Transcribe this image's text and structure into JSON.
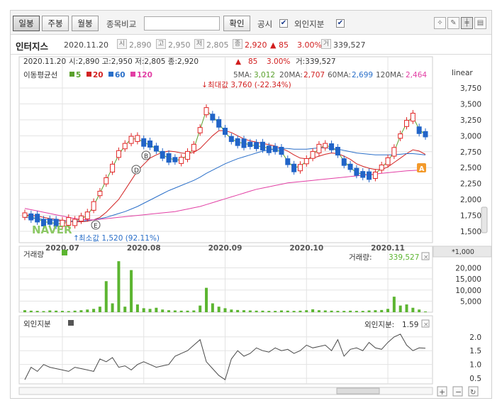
{
  "toolbar": {
    "periods": [
      "일봉",
      "주봉",
      "월봉"
    ],
    "compare_label": "종목비교",
    "compare_value": "",
    "confirm_label": "확인",
    "disclosure_label": "공시",
    "foreign_label": "외인지분",
    "icons": [
      "lightbulb-icon",
      "pencil-icon",
      "chart-type-icon",
      "print-icon"
    ]
  },
  "info": {
    "name": "인터지스",
    "date": "2020.11.20",
    "open_tag": "시",
    "open": "2,890",
    "high_tag": "고",
    "high": "2,950",
    "low_tag": "저",
    "low": "2,805",
    "close_tag": "종",
    "close": "2,920",
    "change": "▲ 85",
    "change_pct": "3.00%",
    "volume_tag": "거",
    "volume": "339,527"
  },
  "legend_line": {
    "date": "2020.11.20",
    "text": "시:2,890 고:2,950 저:2,805 종:2,920",
    "arrow": "▲",
    "change": "85",
    "pct": "3.00%",
    "vol": "거:339,527"
  },
  "ma_legend": {
    "title": "이동평균선",
    "items": [
      {
        "label": "5",
        "color": "#5aa02c"
      },
      {
        "label": "20",
        "color": "#d22222"
      },
      {
        "label": "60",
        "color": "#2a6fc9"
      },
      {
        "label": "120",
        "color": "#e23fa4"
      }
    ]
  },
  "ma_values": {
    "ma5_label": "5MA:",
    "ma5": "3,012",
    "ma20_label": "20MA:",
    "ma20": "2,707",
    "ma60_label": "60MA:",
    "ma60": "2,699",
    "ma120_label": "120MA:",
    "ma120": "2,464"
  },
  "scale_label": "linear",
  "max_annotation": "최대값 3,760 (-22.34%)",
  "min_annotation": "최소값 1,520 (92.11%)",
  "watermark": "NAVER",
  "marker_labels": [
    "B",
    "D",
    "E"
  ],
  "alert_marker": "A",
  "volume_panel": {
    "title": "거래량",
    "value_label": "거래량:",
    "value": "339,527",
    "unit": "*1,000"
  },
  "foreign_panel": {
    "title": "외인지분",
    "value_label": "외인지분:",
    "value": "1.59"
  },
  "colors": {
    "up": "#e12525",
    "down": "#2164c8",
    "volume": "#5cb531",
    "foreign": "#4a4a4a",
    "grid": "#e3e3e3"
  },
  "chart_data": [
    {
      "type": "line",
      "title": "",
      "x_ticks": [
        "2020.07",
        "2020.08",
        "2020.09",
        "2020.10",
        "2020.11"
      ],
      "y_ticks": [
        1500,
        1750,
        2000,
        2250,
        2500,
        2750,
        3000,
        3250,
        3500,
        3750
      ],
      "ylim": [
        1400,
        3850
      ],
      "series": [
        {
          "name": "5",
          "values": [
            1760,
            1720,
            1700,
            1650,
            1640,
            1620,
            1620,
            1650,
            1660,
            1700,
            1750,
            1900,
            2100,
            2300,
            2500,
            2700,
            2850,
            2950,
            2950,
            2900,
            2850,
            2800,
            2700,
            2650,
            2620,
            2620,
            2700,
            2800,
            3100,
            3400,
            3300,
            3200,
            3050,
            2950,
            2900,
            2880,
            2860,
            2840,
            2830,
            2800,
            2780,
            2750,
            2600,
            2500,
            2520,
            2600,
            2700,
            2800,
            2850,
            2820,
            2750,
            2600,
            2500,
            2420,
            2400,
            2380,
            2400,
            2500,
            2600,
            2750,
            3000,
            3200,
            3300,
            3100,
            3012
          ]
        },
        {
          "name": "20",
          "values": [
            1760,
            1750,
            1740,
            1720,
            1700,
            1690,
            1670,
            1660,
            1650,
            1650,
            1660,
            1680,
            1720,
            1800,
            1900,
            2000,
            2150,
            2300,
            2450,
            2550,
            2650,
            2700,
            2740,
            2760,
            2750,
            2730,
            2720,
            2740,
            2800,
            2900,
            3000,
            3080,
            3080,
            3050,
            3000,
            2950,
            2920,
            2900,
            2880,
            2860,
            2840,
            2800,
            2760,
            2700,
            2650,
            2640,
            2650,
            2680,
            2710,
            2730,
            2720,
            2680,
            2630,
            2560,
            2520,
            2490,
            2470,
            2470,
            2510,
            2580,
            2650,
            2720,
            2780,
            2760,
            2707
          ]
        },
        {
          "name": "60",
          "values": [
            1720,
            1710,
            1700,
            1690,
            1680,
            1670,
            1660,
            1660,
            1660,
            1660,
            1670,
            1680,
            1700,
            1720,
            1750,
            1780,
            1810,
            1850,
            1890,
            1940,
            1990,
            2040,
            2090,
            2140,
            2180,
            2220,
            2260,
            2300,
            2350,
            2410,
            2460,
            2510,
            2560,
            2600,
            2640,
            2670,
            2700,
            2730,
            2760,
            2780,
            2790,
            2800,
            2800,
            2790,
            2790,
            2790,
            2800,
            2810,
            2810,
            2800,
            2790,
            2770,
            2750,
            2730,
            2720,
            2710,
            2700,
            2700,
            2700,
            2700,
            2710,
            2720,
            2720,
            2710,
            2699
          ]
        },
        {
          "name": "120",
          "values": [
            1860,
            1840,
            1820,
            1800,
            1780,
            1760,
            1740,
            1720,
            1700,
            1690,
            1680,
            1680,
            1690,
            1700,
            1710,
            1720,
            1730,
            1740,
            1750,
            1760,
            1770,
            1780,
            1790,
            1800,
            1810,
            1830,
            1850,
            1870,
            1890,
            1920,
            1950,
            1980,
            2010,
            2040,
            2070,
            2100,
            2130,
            2160,
            2180,
            2200,
            2220,
            2240,
            2260,
            2270,
            2280,
            2290,
            2300,
            2310,
            2320,
            2330,
            2340,
            2350,
            2360,
            2370,
            2380,
            2390,
            2400,
            2410,
            2420,
            2430,
            2440,
            2450,
            2455,
            2460,
            2464
          ]
        }
      ]
    },
    {
      "type": "bar",
      "title": "",
      "x_ticks": [
        "2020.07",
        "2020.08",
        "2020.09",
        "2020.10",
        "2020.11"
      ],
      "y_ticks": [
        5000,
        10000,
        15000,
        20000
      ],
      "ylim": [
        0,
        24000
      ],
      "series": [
        {
          "name": "거래량",
          "values": [
            900,
            700,
            600,
            500,
            800,
            700,
            600,
            500,
            700,
            900,
            1200,
            1500,
            2500,
            14000,
            4000,
            23000,
            2500,
            19000,
            3500,
            1800,
            1500,
            2000,
            1200,
            900,
            800,
            700,
            700,
            800,
            3000,
            11000,
            4000,
            2500,
            1800,
            1200,
            1000,
            900,
            800,
            700,
            700,
            600,
            600,
            800,
            700,
            600,
            700,
            900,
            1300,
            900,
            800,
            700,
            600,
            600,
            700,
            600,
            600,
            800,
            900,
            1000,
            1500,
            7000,
            3000,
            3500,
            2000,
            1200,
            339.5
          ]
        }
      ]
    },
    {
      "type": "line",
      "title": "",
      "x_ticks": [
        "2020.07",
        "2020.08",
        "2020.09",
        "2020.10",
        "2020.11"
      ],
      "y_ticks": [
        0.5,
        1.0,
        1.5,
        2.0
      ],
      "ylim": [
        0.4,
        2.2
      ],
      "series": [
        {
          "name": "외인지분",
          "values": [
            0.45,
            0.9,
            0.75,
            1.0,
            0.9,
            0.85,
            0.8,
            0.75,
            0.9,
            0.85,
            0.8,
            0.75,
            1.2,
            1.1,
            1.25,
            0.9,
            0.95,
            0.8,
            1.0,
            1.1,
            1.0,
            0.9,
            0.95,
            1.0,
            1.3,
            1.4,
            1.5,
            1.7,
            1.9,
            1.1,
            0.85,
            0.6,
            0.45,
            1.2,
            1.5,
            1.3,
            1.4,
            1.6,
            1.5,
            1.45,
            1.6,
            1.5,
            1.55,
            1.4,
            1.5,
            1.7,
            1.6,
            1.65,
            1.7,
            1.5,
            1.9,
            1.3,
            1.55,
            1.6,
            1.5,
            1.8,
            1.6,
            1.55,
            1.8,
            2.0,
            2.1,
            1.7,
            1.5,
            1.6,
            1.59
          ]
        }
      ]
    }
  ]
}
